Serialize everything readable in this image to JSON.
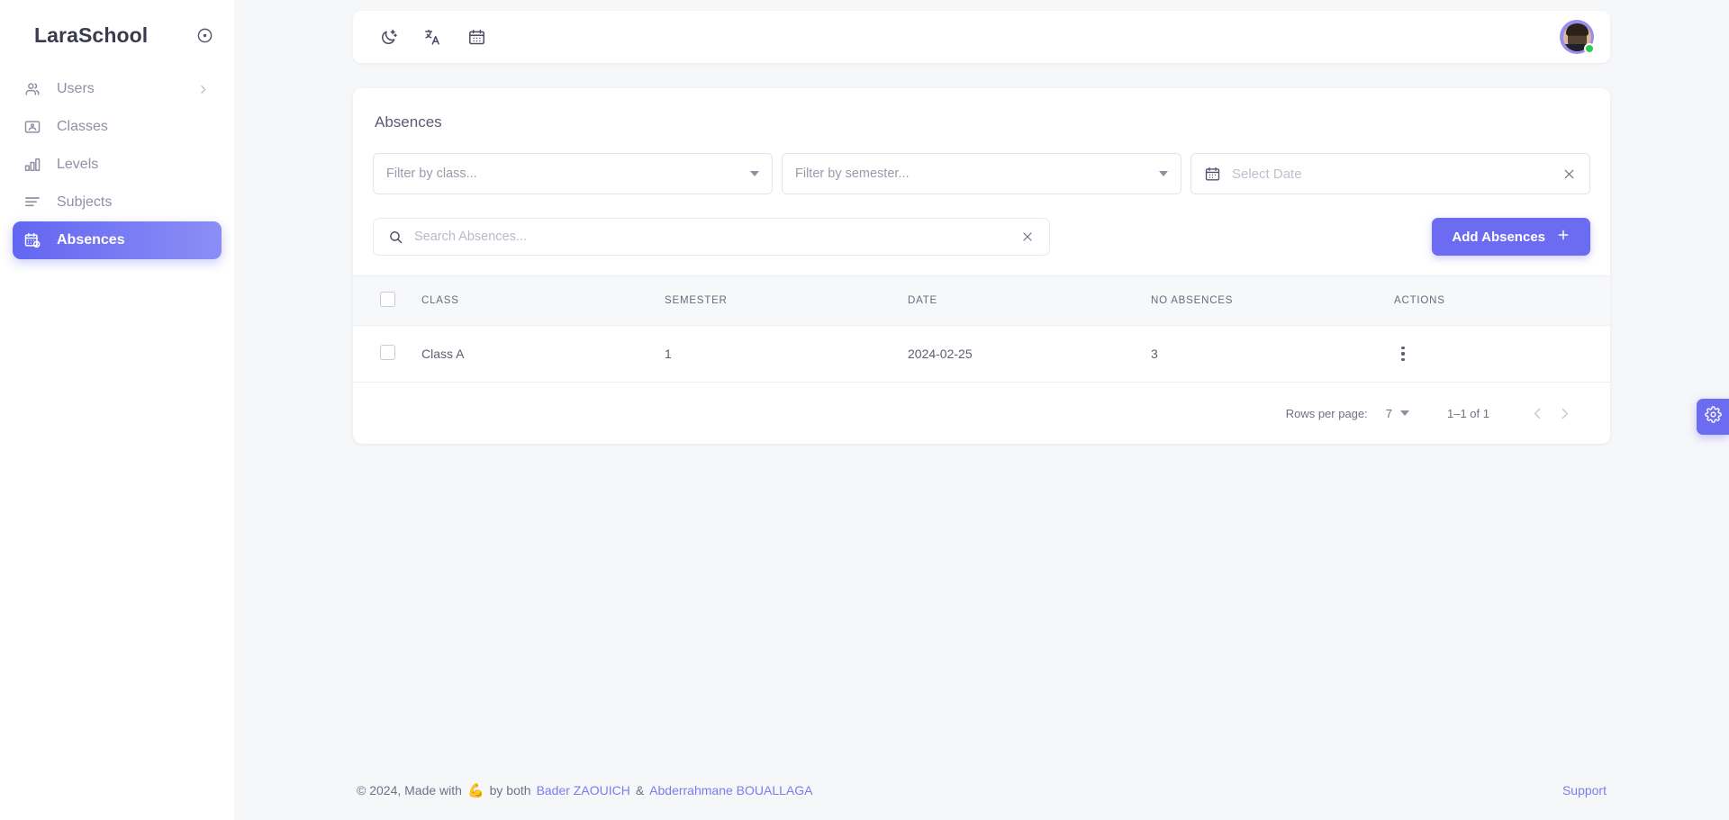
{
  "sidebar": {
    "brand": "LaraSchool",
    "toggle_icon": "target-circle-icon",
    "items": [
      {
        "label": "Users",
        "icon": "users-icon",
        "active": false,
        "has_chevron": true
      },
      {
        "label": "Classes",
        "icon": "classroom-icon",
        "active": false,
        "has_chevron": false
      },
      {
        "label": "Levels",
        "icon": "bar-chart-icon",
        "active": false,
        "has_chevron": false
      },
      {
        "label": "Subjects",
        "icon": "list-lines-icon",
        "active": false,
        "has_chevron": false
      },
      {
        "label": "Absences",
        "icon": "calendar-clock-icon",
        "active": true,
        "has_chevron": false
      }
    ]
  },
  "topbar": {
    "dark_mode_icon": "moon-stars-icon",
    "language_icon": "translate-icon",
    "calendar_icon": "calendar-icon",
    "avatar_alt": "user-avatar",
    "status": "online"
  },
  "card": {
    "title": "Absences",
    "filters": {
      "class_placeholder": "Filter by class...",
      "semester_placeholder": "Filter by semester...",
      "date_placeholder": "Select Date",
      "date_icon": "calendar-icon",
      "clear_icon": "close-icon"
    },
    "search": {
      "placeholder": "Search Absences...",
      "value": "",
      "icon": "search-icon",
      "clear_icon": "close-icon"
    },
    "add_button": {
      "label": "Add Absences",
      "icon": "plus-icon"
    },
    "table": {
      "columns": [
        "CLASS",
        "SEMESTER",
        "DATE",
        "NO ABSENCES",
        "ACTIONS"
      ],
      "rows": [
        {
          "class": "Class A",
          "semester": "1",
          "date": "2024-02-25",
          "no_absences": "3",
          "actions_icon": "kebab-menu-icon"
        }
      ]
    },
    "pagination": {
      "rows_per_page_label": "Rows per page:",
      "rows_per_page_value": "7",
      "range": "1–1 of 1",
      "prev_icon": "chevron-left-icon",
      "next_icon": "chevron-right-icon"
    }
  },
  "footer": {
    "copyright": "© 2024, Made with",
    "emoji": "💪",
    "by": "by both",
    "author1": "Bader ZAOUICH",
    "amp": "&",
    "author2": "Abderrahmane BOUALLAGA",
    "support": "Support"
  },
  "settings_tab": {
    "icon": "gear-icon"
  },
  "colors": {
    "accent": "#6c6cf0",
    "accent_gradient_start": "#6366f1",
    "accent_gradient_end": "#8b8ef5",
    "background": "#f6f7f9",
    "card": "#ffffff",
    "status_online": "#2ecc57",
    "link": "#7a7cf0"
  }
}
